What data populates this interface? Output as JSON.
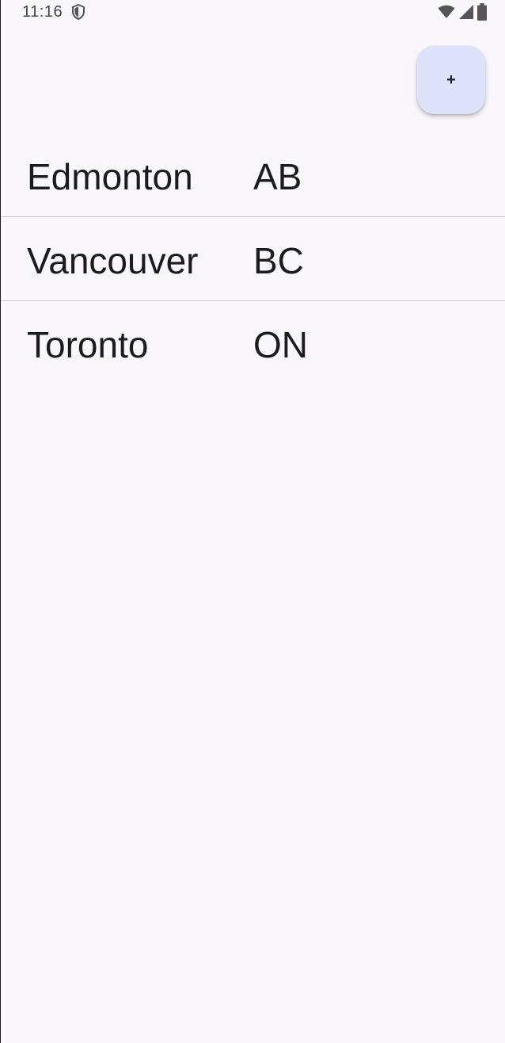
{
  "status_bar": {
    "time": "11:16",
    "icons": [
      "shield-icon",
      "wifi-icon",
      "signal-icon",
      "battery-icon"
    ]
  },
  "fab": {
    "label": "+"
  },
  "cities": [
    {
      "name": "Edmonton",
      "province": "AB"
    },
    {
      "name": "Vancouver",
      "province": "BC"
    },
    {
      "name": "Toronto",
      "province": "ON"
    }
  ],
  "colors": {
    "background": "#f9f6fc",
    "fab_background": "#dde3fb",
    "text": "#1c1b1f",
    "divider": "#c9c6cc"
  }
}
